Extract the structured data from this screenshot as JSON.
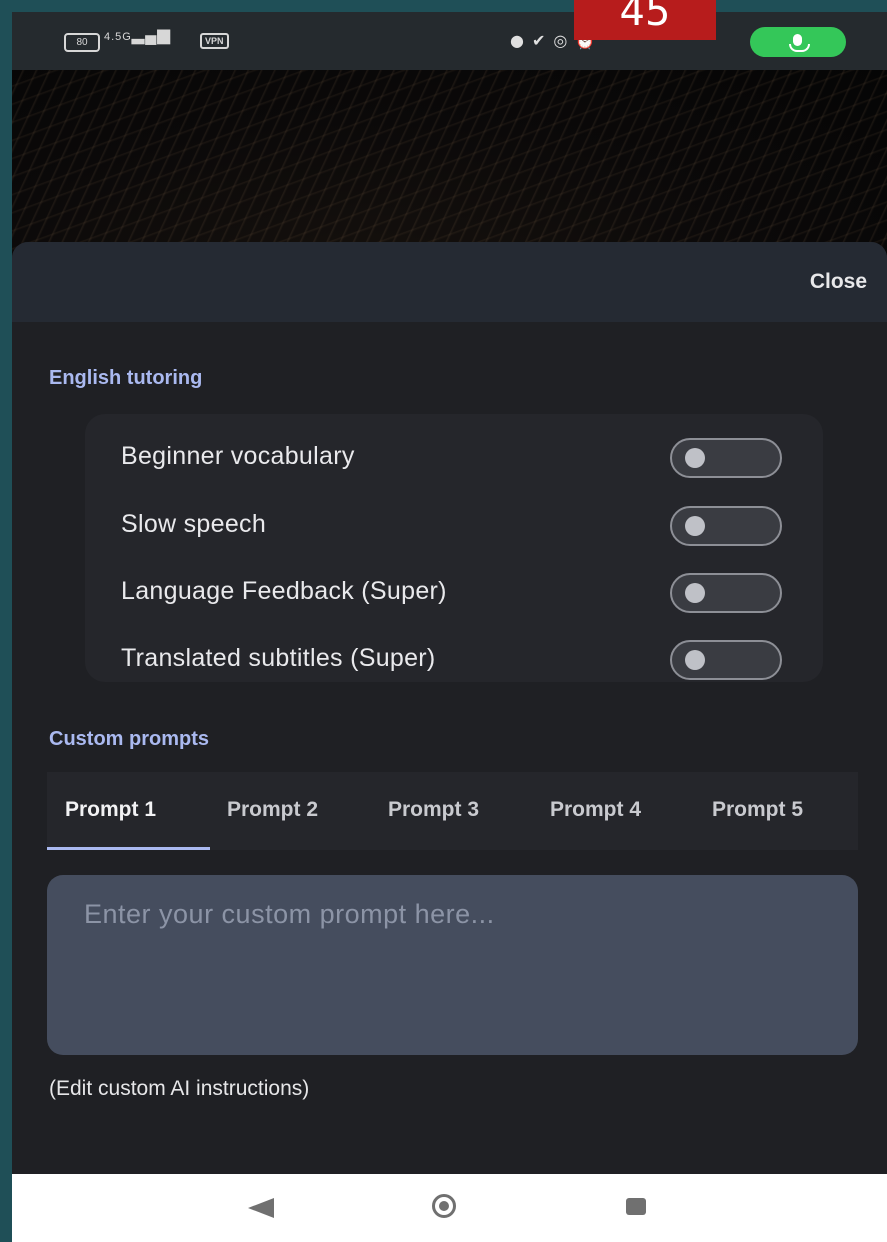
{
  "slide_number": "45",
  "status_bar": {
    "battery": "80",
    "network": "4.5G",
    "vpn": "VPN",
    "icons": [
      "bag-icon",
      "check-icon",
      "whatsapp-icon",
      "alarm-icon",
      "mic-indicator-icon"
    ],
    "mic_color": "#34c759"
  },
  "sheet": {
    "close_label": "Close",
    "english_tutoring": {
      "title": "English tutoring",
      "options": [
        {
          "label": "Beginner vocabulary",
          "enabled": false
        },
        {
          "label": "Slow speech",
          "enabled": false
        },
        {
          "label": "Language Feedback (Super)",
          "enabled": false
        },
        {
          "label": "Translated subtitles (Super)",
          "enabled": false
        }
      ]
    },
    "custom_prompts": {
      "title": "Custom prompts",
      "tabs": [
        {
          "label": "Prompt 1",
          "active": true
        },
        {
          "label": "Prompt 2",
          "active": false
        },
        {
          "label": "Prompt 3",
          "active": false
        },
        {
          "label": "Prompt 4",
          "active": false
        },
        {
          "label": "Prompt 5",
          "active": false
        }
      ],
      "placeholder": "Enter your custom prompt here...",
      "value": "",
      "hint": "(Edit custom AI instructions)"
    }
  },
  "nav_bar": {
    "icons": [
      "back-icon",
      "home-icon",
      "recents-icon"
    ]
  },
  "colors": {
    "accent": "#aab9f0",
    "sheet_background": "#1f2024",
    "badge": "#b71c1c"
  }
}
